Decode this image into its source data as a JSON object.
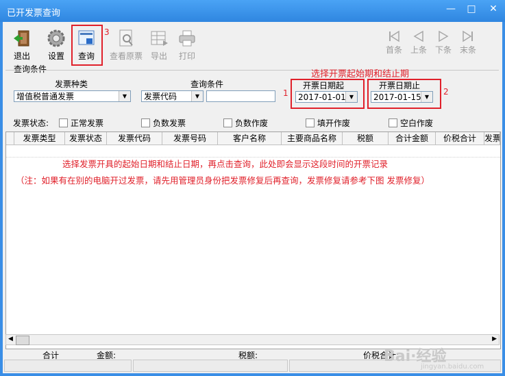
{
  "window": {
    "title": "已开发票查询",
    "min": "—",
    "max": "□",
    "close": "✕"
  },
  "toolbar": {
    "exit_label": "退出",
    "settings_label": "设置",
    "query_label": "查询",
    "view_original_label": "查看原票",
    "export_label": "导出",
    "print_label": "打印",
    "first_label": "首条",
    "prev_label": "上条",
    "next_label": "下条",
    "last_label": "末条"
  },
  "annotations": {
    "num1": "1",
    "num2": "2",
    "num3": "3",
    "top_hint": "选择开票起始期和结止期",
    "grid_hint1": "选择发票开具的起始日期和结止日期，再点击查询，此处即会显示这段时间的开票记录",
    "grid_hint2": "（注：如果有在别的电脑开过发票，请先用管理员身份把发票修复后再查询，发票修复请参考下图  发票修复）",
    "color": "#e0202a"
  },
  "query": {
    "group_label": "查询条件",
    "invoice_type_label": "发票种类",
    "invoice_type_value": "增值税普通发票",
    "condition_label": "查询条件",
    "condition_field_value": "发票代码",
    "condition_text_value": "",
    "start_date_label": "开票日期起",
    "start_date_value": "2017-01-01",
    "end_date_label": "开票日期止",
    "end_date_value": "2017-01-15"
  },
  "status_filter": {
    "label": "发票状态:",
    "options": [
      "正常发票",
      "负数发票",
      "负数作废",
      "填开作废",
      "空白作废"
    ]
  },
  "grid": {
    "columns": [
      "发票类型",
      "发票状态",
      "发票代码",
      "发票号码",
      "客户名称",
      "主要商品名称",
      "税额",
      "合计金额",
      "价税合计",
      "发票作"
    ]
  },
  "summary": {
    "total_label": "合计",
    "amount_label": "金额:",
    "tax_label": "税额:",
    "price_tax_label": "价税合计:"
  },
  "watermark": {
    "text": "Bai·经验",
    "sub": "jingyan.baidu.com"
  }
}
